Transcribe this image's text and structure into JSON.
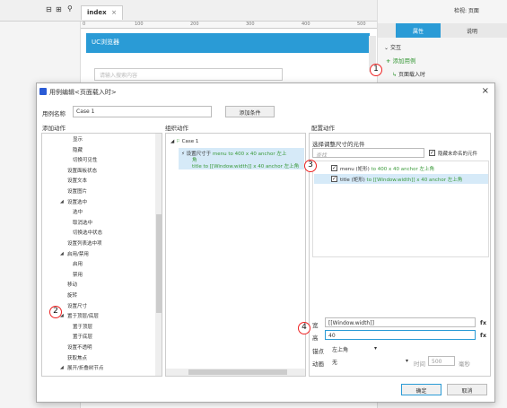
{
  "editor": {
    "toolbar_icons": [
      "layout-icon",
      "grid-icon",
      "zoom-icon"
    ],
    "tab_label": "index",
    "ruler_ticks": [
      "0",
      "100",
      "200",
      "300",
      "400",
      "500"
    ],
    "canvas_header": "UC浏览器",
    "canvas_search_placeholder": "请输入搜索内容"
  },
  "right_panel": {
    "tabs": [
      "属性",
      "说明"
    ],
    "top_labels": [
      "检视: 页面"
    ],
    "section": "交互",
    "add_case": "添加用例",
    "event": "页面载入时"
  },
  "dialog": {
    "title": "用例编辑<页面载入时>",
    "case_name_label": "用例名称",
    "case_name_value": "Case 1",
    "add_condition": "添加条件",
    "col1_title": "添加动作",
    "col2_title": "组织动作",
    "col3_title": "配置动作",
    "actions": [
      {
        "label": "显示",
        "indent": 2
      },
      {
        "label": "隐藏",
        "indent": 2
      },
      {
        "label": "切换可见性",
        "indent": 2
      },
      {
        "label": "设置面板状态",
        "indent": 1
      },
      {
        "label": "设置文本",
        "indent": 1
      },
      {
        "label": "设置图片",
        "indent": 1
      },
      {
        "label": "设置选中",
        "indent": 1,
        "caret": true
      },
      {
        "label": "选中",
        "indent": 2
      },
      {
        "label": "取消选中",
        "indent": 2
      },
      {
        "label": "切换选中状态",
        "indent": 2
      },
      {
        "label": "设置列表选中项",
        "indent": 1
      },
      {
        "label": "启用/禁用",
        "indent": 1,
        "caret": true
      },
      {
        "label": "启用",
        "indent": 2
      },
      {
        "label": "禁用",
        "indent": 2
      },
      {
        "label": "移动",
        "indent": 1
      },
      {
        "label": "旋转",
        "indent": 1
      },
      {
        "label": "设置尺寸",
        "indent": 1
      },
      {
        "label": "置于顶层/底层",
        "indent": 1,
        "caret": true
      },
      {
        "label": "置于顶层",
        "indent": 2
      },
      {
        "label": "置于底层",
        "indent": 2
      },
      {
        "label": "设置不透明",
        "indent": 1
      },
      {
        "label": "获取焦点",
        "indent": 1
      },
      {
        "label": "展开/折叠树节点",
        "indent": 1,
        "caret": true
      }
    ],
    "organize": {
      "case": "Case 1",
      "action_title": "设置尺寸于",
      "action_line1": "menu to 400 x 40 anchor 左上",
      "action_line2": "角",
      "action_line3": "title to [[Window.width]] x 40 anchor 左上角"
    },
    "config": {
      "select_label": "选择调整尺寸的元件",
      "search_placeholder": "查找",
      "hide_unnamed": "隐藏未命名的元件",
      "widgets": [
        {
          "name": "menu (矩形)",
          "detail": " to 400 x 40 anchor 左上角",
          "checked": true
        },
        {
          "name": "title (矩形)",
          "detail": " to [[Window.width]] x 40 anchor 左上角",
          "checked": true
        }
      ],
      "width_label": "宽",
      "width_value": "[[Window.width]]",
      "height_label": "高",
      "height_value": "40",
      "fx": "fx",
      "anchor_label": "锚点",
      "anchor_value": "左上角",
      "anim_label": "动画",
      "anim_value": "无",
      "time_label": "时间",
      "time_value": "500",
      "ms_label": "毫秒"
    },
    "ok": "确定",
    "cancel": "取消"
  },
  "markers": [
    "1",
    "2",
    "3",
    "4"
  ],
  "colors": {
    "accent": "#2a9bd6",
    "marker": "#e22222",
    "green": "#3a9a3a"
  }
}
